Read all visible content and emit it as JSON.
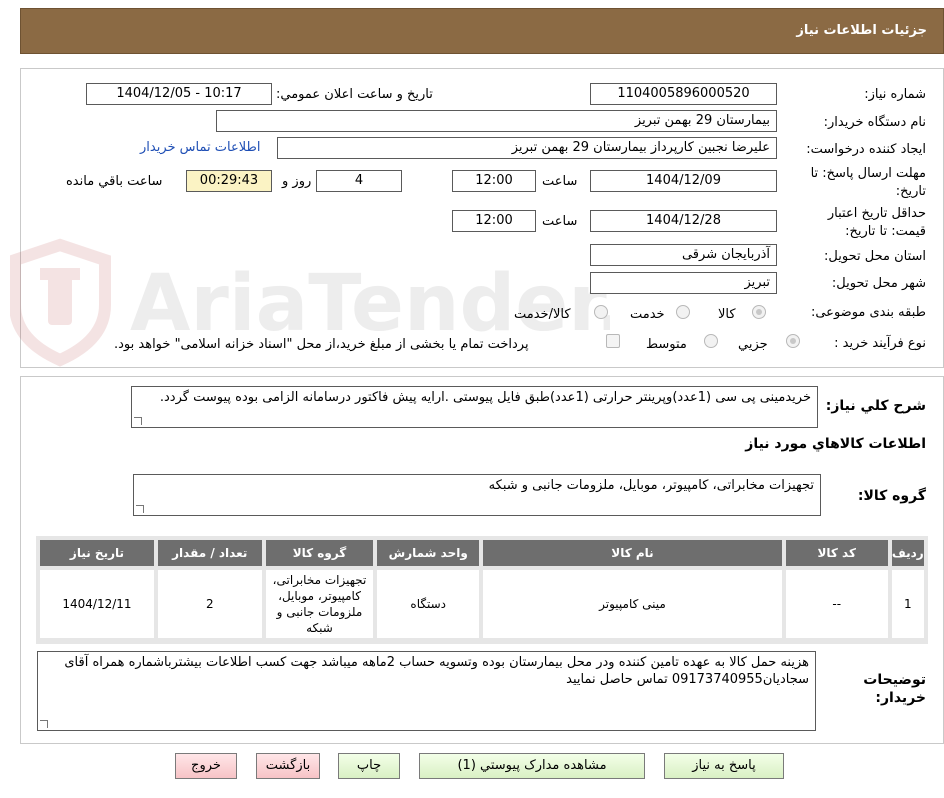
{
  "header": {
    "title": "جزئیات اطلاعات نیاز"
  },
  "watermark": {
    "text": "AriaTender.neT"
  },
  "form": {
    "need_number_label": "شماره نیاز:",
    "need_number": "1104005896000520",
    "announce_label": "تاریخ و ساعت اعلان عمومي:",
    "announce_value": "1404/12/05 - 10:17",
    "buyer_org_label": "نام دستگاه خريدار:",
    "buyer_org": "بیمارستان 29 بهمن تبریز",
    "requester_label": "ايجاد کننده درخواست:",
    "requester": "علیرضا نجبین کارپرداز بیمارستان 29 بهمن تبریز",
    "contact_link": "اطلاعات تماس خريدار",
    "deadline_label_line1": "مهلت ارسال پاسخ: تا",
    "deadline_label_line2": "تاريخ:",
    "deadline_date": "1404/12/09",
    "time_label": "ساعت",
    "deadline_time": "12:00",
    "days_value": "4",
    "days_label": "روز و",
    "remaining_time": "00:29:43",
    "remaining_label": "ساعت باقي مانده",
    "validity_label_line1": "حداقل تاريخ اعتبار",
    "validity_label_line2": "قيمت: تا تاريخ:",
    "validity_date": "1404/12/28",
    "validity_time": "12:00",
    "province_label": "استان محل تحويل:",
    "province": "آذربایجان شرقی",
    "city_label": "شهر محل تحويل:",
    "city": "تبریز",
    "category_label": "طبقه بندی موضوعی:",
    "category_options": [
      "کالا",
      "خدمت",
      "کالا/خدمت"
    ],
    "process_label": "نوع فرآیند خرید :",
    "process_options": [
      "جزیي",
      "متوسط"
    ],
    "payment_note": "پرداخت تمام یا بخشی از مبلغ خرید،از محل \"اسناد خزانه اسلامی\" خواهد بود."
  },
  "description": {
    "summary_label": "شرح کلي نياز:",
    "summary_text": "خریدمینی پی سی (1عدد)وپرینتر حرارتی (1عدد)طبق فایل پیوستی .ارایه پیش فاکتور درسامانه الزامی بوده پیوست گردد.",
    "items_info_title": "اطلاعات کالاهاي مورد نياز",
    "group_label": "گروه کالا:",
    "group_text": "تجهیزات مخابراتی، کامپیوتر، موبایل، ملزومات جانبی و شبکه"
  },
  "table": {
    "headers": [
      "رديف",
      "کد کالا",
      "نام کالا",
      "واحد شمارش",
      "گروه کالا",
      "تعداد / مقدار",
      "تاريخ نياز"
    ],
    "rows": [
      [
        "1",
        "--",
        "مینی کامپیوتر",
        "دستگاه",
        "تجهیزات مخابراتی، کامپیوتر، موبایل، ملزومات جانبی و شبکه",
        "2",
        "1404/12/11"
      ]
    ]
  },
  "notes": {
    "label_line1": "توضيحات",
    "label_line2": "خريدار:",
    "text": "هزینه حمل کالا به عهده تامین کننده ودر محل بیمارستان بوده وتسویه حساب 2ماهه میباشد جهت کسب اطلاعات بیشترباشماره همراه آقای سجادیان09173740955 تماس حاصل نمایید"
  },
  "buttons": {
    "reply": "پاسخ به نياز",
    "attachments": "مشاهده مدارک پيوستي (1)",
    "print": "چاپ",
    "back": "بازگشت",
    "exit": "خروج"
  },
  "colors": {
    "header": "#8b6a44",
    "table_header": "#6e6e6e",
    "timer_bg": "#fbf3c4",
    "link": "#1f4fb5"
  }
}
